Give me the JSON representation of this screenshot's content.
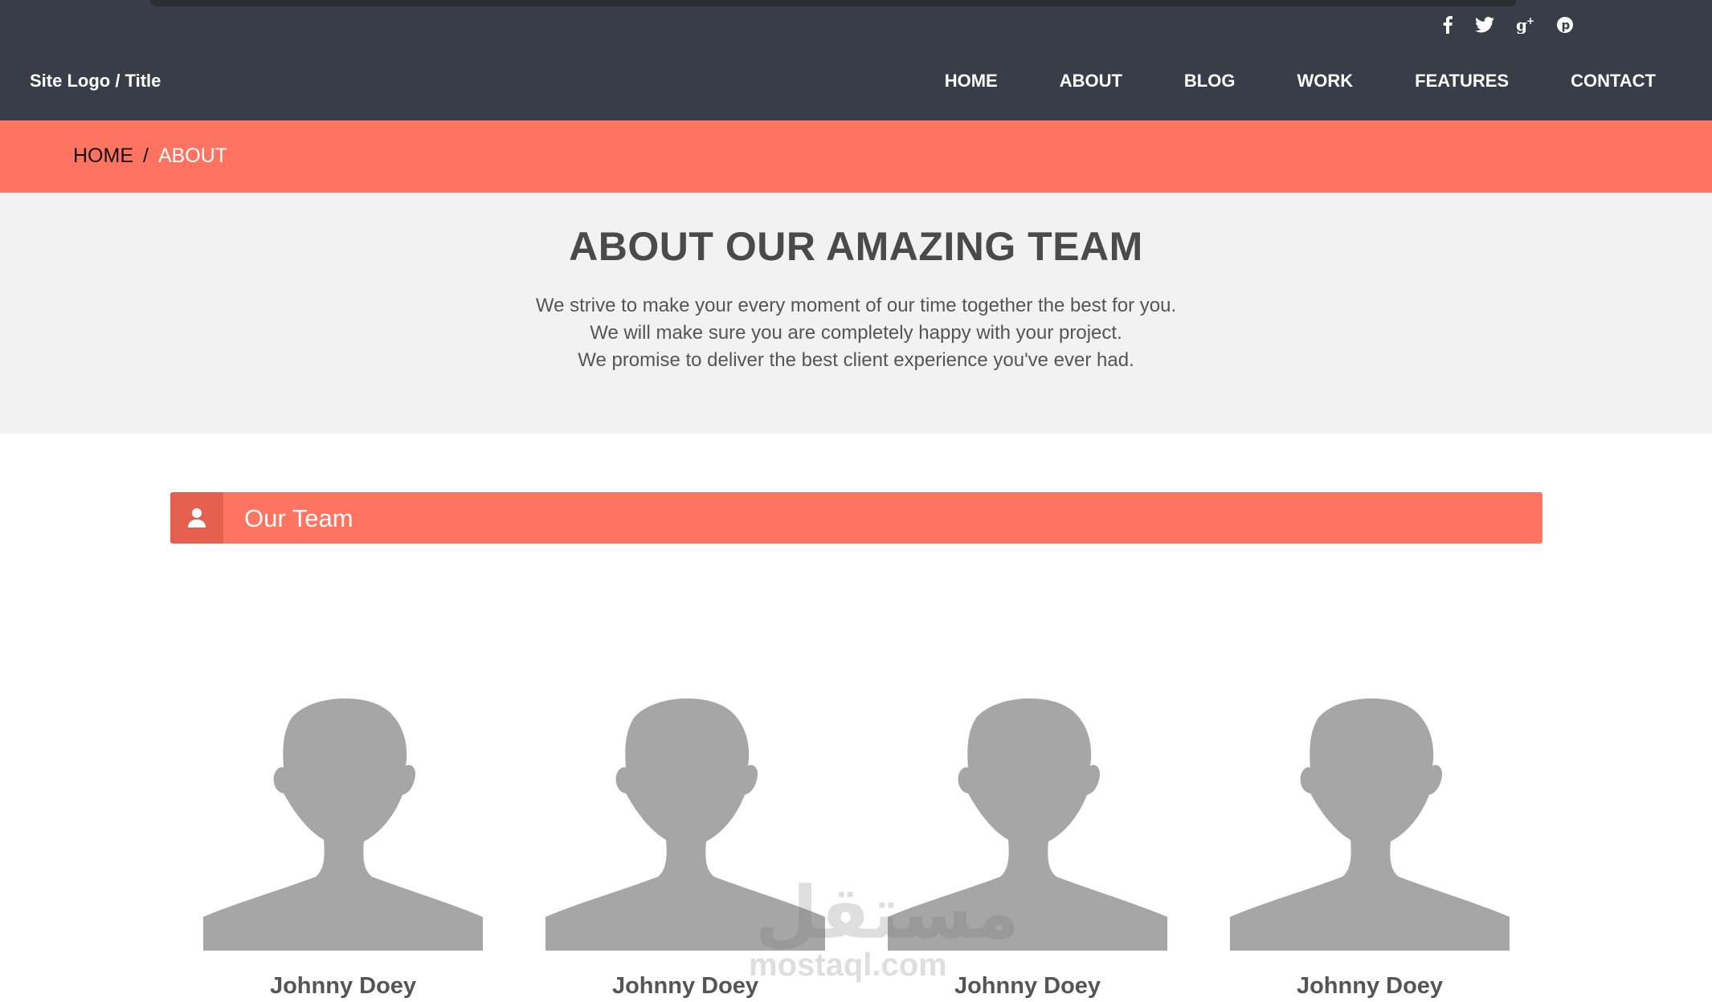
{
  "header": {
    "logo": "Site Logo / Title",
    "social": [
      {
        "icon": "facebook-icon"
      },
      {
        "icon": "twitter-icon"
      },
      {
        "icon": "google-plus-icon"
      },
      {
        "icon": "pinterest-icon"
      }
    ],
    "nav": [
      "HOME",
      "ABOUT",
      "BLOG",
      "WORK",
      "FEATURES",
      "CONTACT"
    ]
  },
  "breadcrumb": {
    "home": "HOME",
    "separator": "/",
    "current": "ABOUT"
  },
  "intro": {
    "title": "ABOUT OUR AMAZING TEAM",
    "lines": [
      "We strive to make your every moment of our time together the best for you.",
      "We will make sure you are completely happy with your project.",
      "We promise to deliver the best client experience you've ever had."
    ]
  },
  "team": {
    "heading": "Our Team",
    "heading_icon": "user-icon",
    "members": [
      {
        "name": "Johnny Doey",
        "avatar": "person-silhouette"
      },
      {
        "name": "Johnny Doey",
        "avatar": "person-silhouette"
      },
      {
        "name": "Johnny Doey",
        "avatar": "person-silhouette"
      },
      {
        "name": "Johnny Doey",
        "avatar": "person-silhouette"
      }
    ]
  },
  "watermark": {
    "arabic": "مستقل",
    "latin": "mostaql.com"
  },
  "colors": {
    "header_bg": "#393d47",
    "accent": "#ff7361",
    "accent_dark": "#e5604f",
    "intro_bg": "#f2f2f2",
    "avatar_gray": "#a5a6a5"
  }
}
